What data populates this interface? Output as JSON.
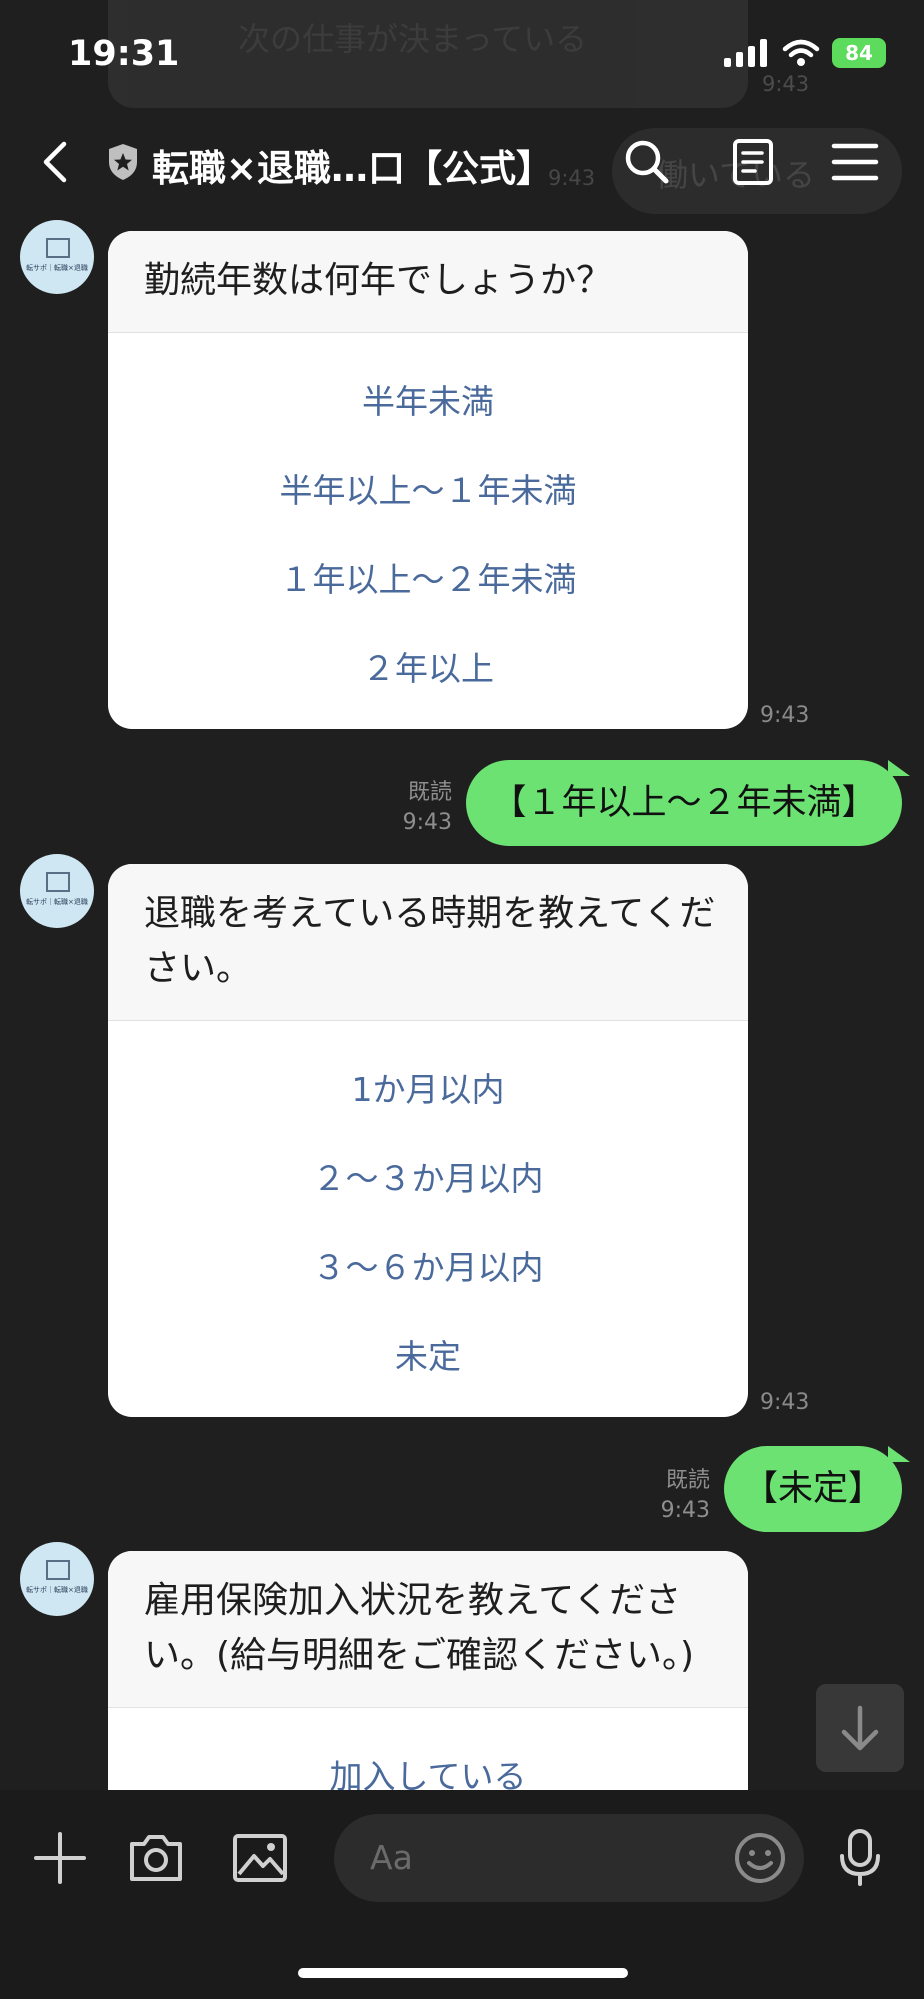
{
  "status": {
    "time": "19:31",
    "battery": "84"
  },
  "ghost": {
    "top_text": "次の仕事が決まっている",
    "top_time": "9:43",
    "right_text": "働いている",
    "right_time": "9:43"
  },
  "header": {
    "title": "転職×退職…口【公式】"
  },
  "avatar": {
    "logo_text": "転サポ｜転職×退職"
  },
  "messages": [
    {
      "question": "勤続年数は何年でしょうか？",
      "options": [
        "半年未満",
        "半年以上〜１年未満",
        "１年以上〜２年未満",
        "２年以上"
      ],
      "time": "9:43"
    },
    {
      "reply": "【１年以上〜２年未満】",
      "read": "既読",
      "time": "9:43"
    },
    {
      "question": "退職を考えている時期を教えてください。",
      "options": [
        "1か月以内",
        "２〜３か月以内",
        "３〜６か月以内",
        "未定"
      ],
      "time": "9:43"
    },
    {
      "reply": "【未定】",
      "read": "既読",
      "time": "9:43"
    },
    {
      "question": "雇用保険加入状況を教えてください。(給与明細をご確認ください。)",
      "options": [
        "加入している"
      ]
    }
  ],
  "input": {
    "placeholder": "Aa"
  },
  "icons": {
    "back": "chevron-left-icon",
    "official": "shield-star-icon",
    "search": "search-icon",
    "notes": "notes-icon",
    "menu": "menu-icon",
    "scroll": "arrow-down-icon",
    "plus": "plus-icon",
    "camera": "camera-icon",
    "image": "image-icon",
    "emoji": "smile-icon",
    "mic": "mic-icon"
  }
}
